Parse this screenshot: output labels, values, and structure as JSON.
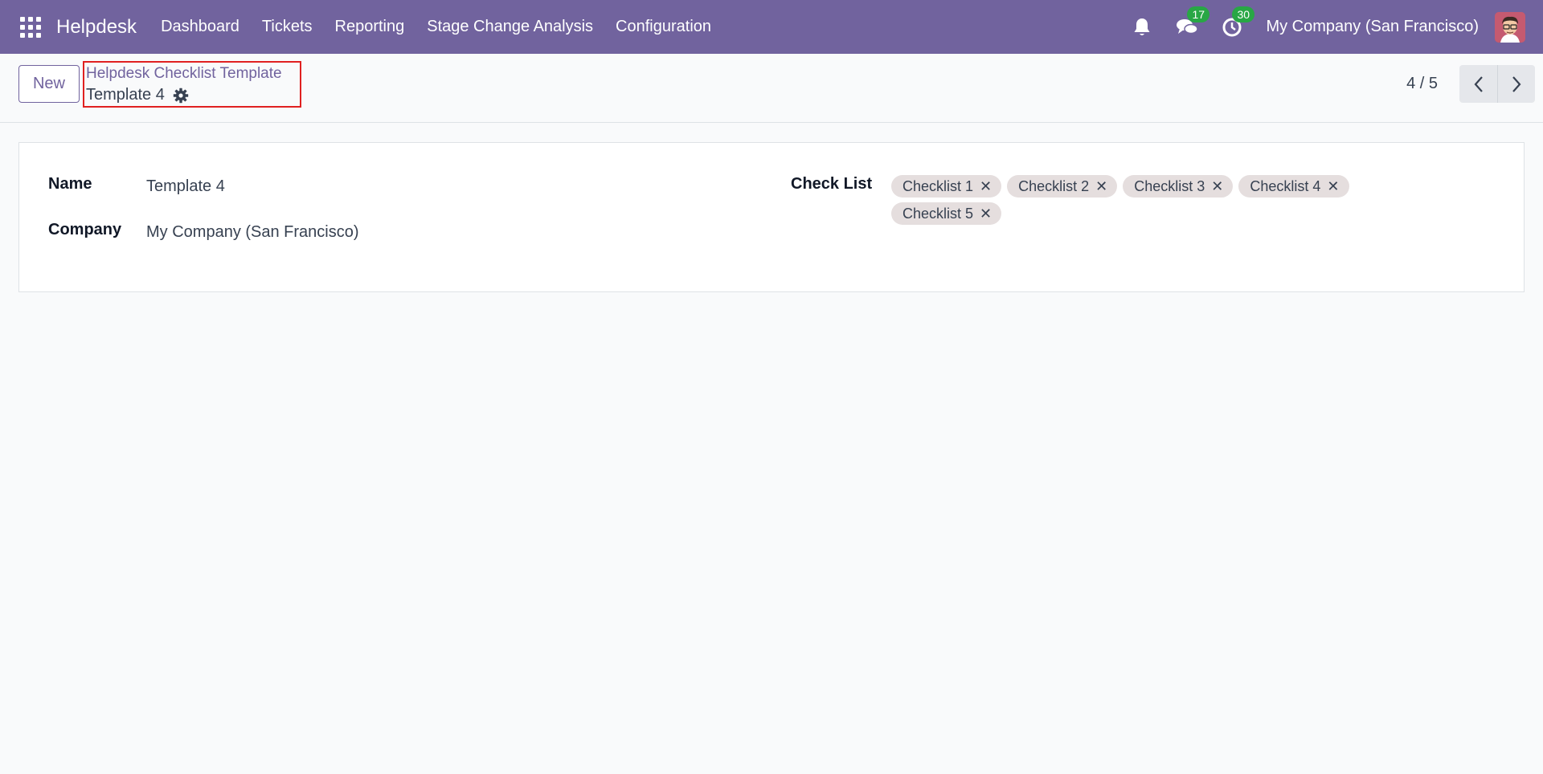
{
  "navbar": {
    "brand": "Helpdesk",
    "menu": [
      "Dashboard",
      "Tickets",
      "Reporting",
      "Stage Change Analysis",
      "Configuration"
    ],
    "messages_count": "17",
    "activities_count": "30",
    "company": "My Company (San Francisco)",
    "accent_color": "#71639e"
  },
  "control_panel": {
    "new_label": "New",
    "breadcrumb_parent": "Helpdesk Checklist Template",
    "breadcrumb_current": "Template 4",
    "pager_value": "4 / 5"
  },
  "form": {
    "name_label": "Name",
    "name_value": "Template 4",
    "company_label": "Company",
    "company_value": "My Company (San Francisco)",
    "checklist_label": "Check List",
    "checklist_tags": [
      "Checklist 1",
      "Checklist 2",
      "Checklist 3",
      "Checklist 4",
      "Checklist 5"
    ],
    "tag_remove_glyph": "✕"
  }
}
